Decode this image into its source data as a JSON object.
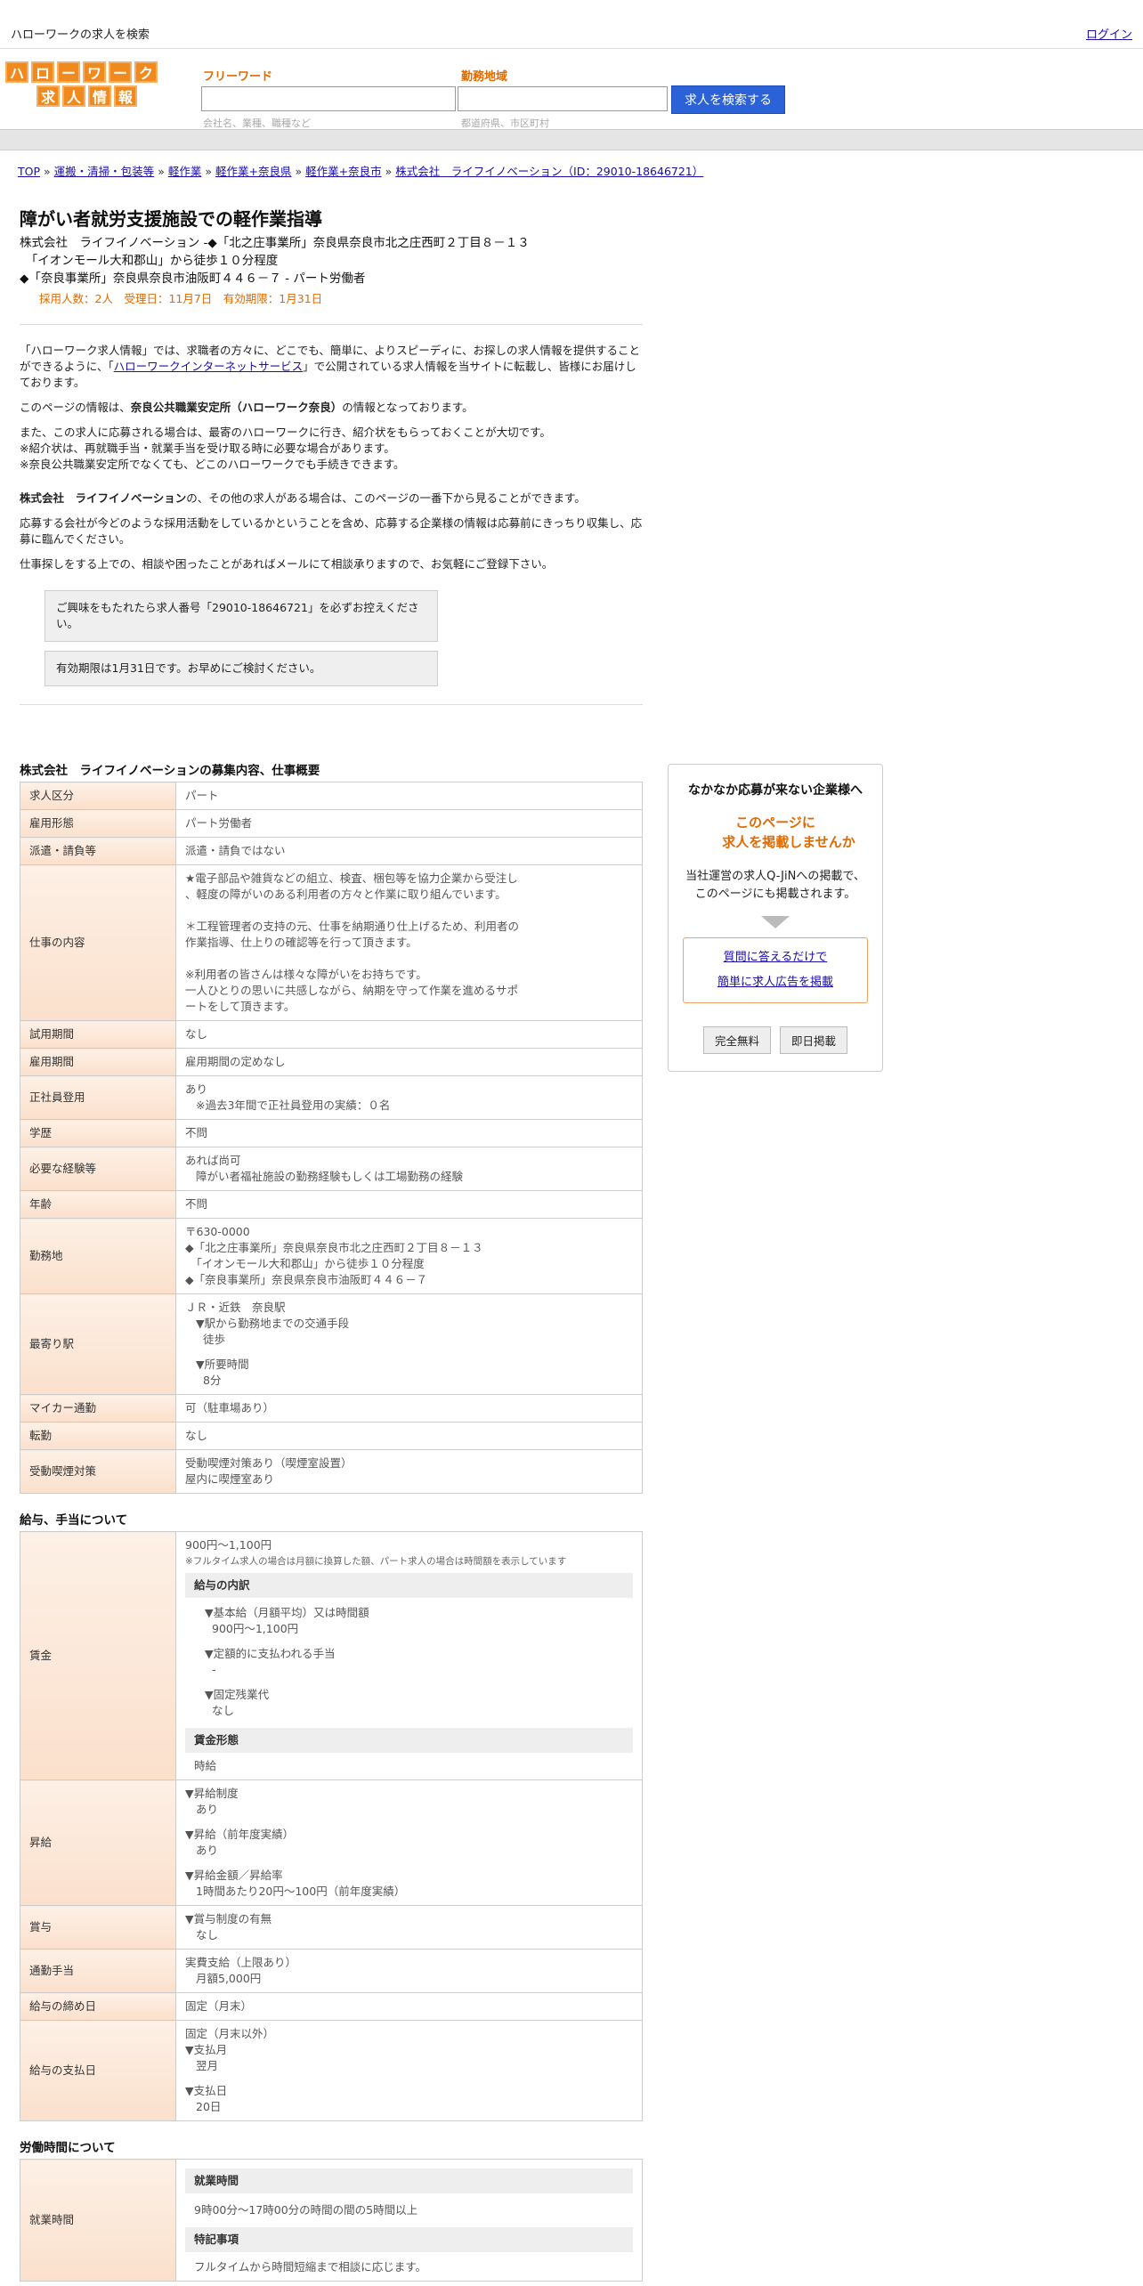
{
  "topbar": {
    "site_title": "ハローワークの求人を検索",
    "login": "ログイン"
  },
  "logo": {
    "row1": [
      "ハ",
      "ロ",
      "ー",
      "ワ",
      "ー",
      "ク"
    ],
    "row2": [
      "求",
      "人",
      "情",
      "報"
    ]
  },
  "search": {
    "freeword_label": "フリーワード",
    "freeword_hint": "会社名、業種、職種など",
    "area_label": "勤務地域",
    "area_hint": "都道府県、市区町村",
    "button": "求人を検索する"
  },
  "breadcrumb": [
    "TOP",
    "運搬・清掃・包装等",
    "軽作業",
    "軽作業+奈良県",
    "軽作業+奈良市",
    "株式会社　ライフイノベーション（ID：29010-18646721）"
  ],
  "job": {
    "title": "障がい者就労支援施設での軽作業指導",
    "addr1": "株式会社　ライフイノベーション -◆「北之庄事業所」奈良県奈良市北之庄西町２丁目８－１３",
    "addr2": "　「イオンモール大和郡山」から徒歩１０分程度",
    "addr3": "◆「奈良事業所」奈良県奈良市油阪町４４６－７ - パート労働者",
    "meta": "採用人数：2人　受理日：11月7日　有効期限：1月31日"
  },
  "intro": {
    "p1_a": "「ハローワーク求人情報」では、求職者の方々に、どこでも、簡単に、よりスピーディに、お探しの求人情報を提供することができるように、「",
    "p1_link": "ハローワークインターネットサービス",
    "p1_b": "」で公開されている求人情報を当サイトに転載し、皆様にお届けしております。",
    "p2_a": "このページの情報は、",
    "p2_b": "奈良公共職業安定所（ハローワーク奈良）",
    "p2_c": "の情報となっております。",
    "p3_1": "また、この求人に応募される場合は、最寄のハローワークに行き、紹介状をもらっておくことが大切です。",
    "p3_2": "※紹介状は、再就職手当・就業手当を受け取る時に必要な場合があります。",
    "p3_3": "※奈良公共職業安定所でなくても、どこのハローワークでも手続きできます。",
    "p4_a": "株式会社　ライフイノベーション",
    "p4_b": "の、その他の求人がある場合は、このページの一番下から見ることができます。",
    "p5": "応募する会社が今どのような採用活動をしているかということを含め、応募する企業様の情報は応募前にきっちり収集し、応募に臨んでください。",
    "p6": "仕事探しをする上での、相談や困ったことがあればメールにて相談承りますので、お気軽にご登録下さい。",
    "note1": "ご興味をもたれたら求人番号「29010-18646721」を必ずお控えください。",
    "note2": "有効期限は1月31日です。お早めにご検討ください。"
  },
  "overview": {
    "title": "株式会社　ライフイノベーションの募集内容、仕事概要",
    "rows": {
      "kubun": [
        "求人区分",
        "パート"
      ],
      "keitai": [
        "雇用形態",
        "パート労働者"
      ],
      "haken": [
        "派遣・請負等",
        "派遣・請負ではない"
      ],
      "naiyo_h": "仕事の内容",
      "naiyo": [
        "★電子部品や雑貨などの組立、検査、梱包等を協力企業から受注し",
        "、軽度の障がいのある利用者の方々と作業に取り組んでいます。",
        "",
        "＊工程管理者の支持の元、仕事を納期通り仕上げるため、利用者の",
        "作業指導、仕上りの確認等を行って頂きます。",
        "",
        "※利用者の皆さんは様々な障がいをお持ちです。",
        "一人ひとりの思いに共感しながら、納期を守って作業を進めるサポ",
        "ートをして頂きます。"
      ],
      "shiyo": [
        "試用期間",
        "なし"
      ],
      "koyo": [
        "雇用期間",
        "雇用期間の定めなし"
      ],
      "seishain_h": "正社員登用",
      "seishain": [
        "あり",
        "※過去3年間で正社員登用の実績：０名"
      ],
      "gakureki": [
        "学歴",
        "不問"
      ],
      "keiken_h": "必要な経験等",
      "keiken": [
        "あれば尚可",
        "障がい者福祉施設の勤務経験もしくは工場勤務の経験"
      ],
      "nenrei": [
        "年齢",
        "不問"
      ],
      "kinmuchi_h": "勤務地",
      "kinmuchi": [
        "〒630-0000",
        "◆「北之庄事業所」奈良県奈良市北之庄西町２丁目８－１３",
        "　「イオンモール大和郡山」から徒歩１０分程度",
        "◆「奈良事業所」奈良県奈良市油阪町４４６－７"
      ],
      "eki_h": "最寄り駅",
      "eki": [
        "ＪＲ・近鉄　奈良駅",
        "▼駅から勤務地までの交通手段",
        "徒歩",
        "▼所要時間",
        "8分"
      ],
      "mycar": [
        "マイカー通勤",
        "可（駐車場あり）"
      ],
      "tenkin": [
        "転勤",
        "なし"
      ],
      "judo_h": "受動喫煙対策",
      "judo": [
        "受動喫煙対策あり（喫煙室設置）",
        "屋内に喫煙室あり"
      ]
    }
  },
  "salary": {
    "title": "給与、手当について",
    "chingin_h": "賃金",
    "chingin": {
      "range": "900円〜1,100円",
      "note": "※フルタイム求人の場合は月額に換算した額、パート求人の場合は時間額を表示しています",
      "breakdown_h": "給与の内訳",
      "b1": "▼基本給（月額平均）又は時間額",
      "b1v": "900円〜1,100円",
      "b2": "▼定額的に支払われる手当",
      "b2v": "-",
      "b3": "▼固定残業代",
      "b3v": "なし",
      "form_h": "賃金形態",
      "form": "時給"
    },
    "shokyu_h": "昇給",
    "shokyu": [
      "▼昇給制度",
      "あり",
      "▼昇給（前年度実績）",
      "あり",
      "▼昇給金額／昇給率",
      "1時間あたり20円〜100円（前年度実績）"
    ],
    "shoyo_h": "賞与",
    "shoyo": [
      "▼賞与制度の有無",
      "なし"
    ],
    "tsukin_h": "通勤手当",
    "tsukin": [
      "実費支給（上限あり）",
      "月額5,000円"
    ],
    "shime": [
      "給与の締め日",
      "固定（月末）"
    ],
    "shiharai_h": "給与の支払日",
    "shiharai": [
      "固定（月末以外）",
      "▼支払月",
      "翌月",
      "▼支払日",
      "20日"
    ]
  },
  "labor": {
    "title": "労働時間について",
    "shugyo_h": "就業時間",
    "sub1": "就業時間",
    "hours": "9時00分〜17時00分の時間の間の5時間以上",
    "sub2": "特記事項",
    "tokki": "フルタイムから時間短縮まで相談に応じます。"
  },
  "sidead": {
    "t1": "なかなか応募が来ない企業様へ",
    "t2a": "このページに",
    "t2b": "求人を掲載しませんか",
    "t3a": "当社運営の求人Q-JiNへの掲載で、",
    "t3b": "このページにも掲載されます。",
    "link1": "質問に答えるだけで",
    "link2": "簡単に求人広告を掲載",
    "btn1": "完全無料",
    "btn2": "即日掲載"
  }
}
